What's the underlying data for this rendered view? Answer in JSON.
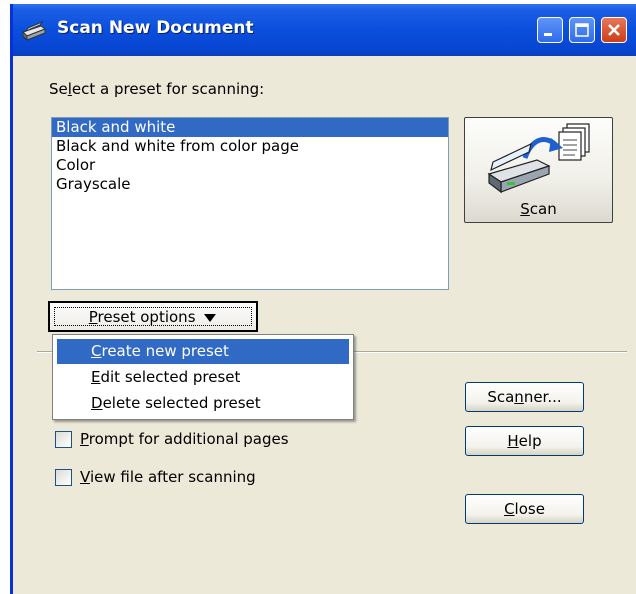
{
  "window": {
    "title": "Scan New Document",
    "buttons": {
      "minimize": "minimize-icon",
      "maximize": "maximize-icon",
      "close": "close-icon"
    }
  },
  "preset_label": {
    "before": "Se",
    "underline": "l",
    "after": "ect a preset for scanning:"
  },
  "presets": [
    {
      "label": "Black and white",
      "selected": true
    },
    {
      "label": "Black and white from color page",
      "selected": false
    },
    {
      "label": "Color",
      "selected": false
    },
    {
      "label": "Grayscale",
      "selected": false
    }
  ],
  "scan_button": {
    "underline": "S",
    "after": "can",
    "icon": "scanner-icon"
  },
  "preset_options_button": {
    "underline": "P",
    "after": "reset options",
    "icon": "dropdown-arrow-icon"
  },
  "preset_menu": [
    {
      "underline": "C",
      "after": "reate new preset",
      "highlighted": true
    },
    {
      "underline": "E",
      "after": "dit selected preset",
      "highlighted": false
    },
    {
      "underline": "D",
      "after": "elete selected preset",
      "highlighted": false
    }
  ],
  "checkboxes": {
    "prompt": {
      "underline": "P",
      "after": "rompt for additional pages",
      "checked": false
    },
    "view": {
      "underline": "V",
      "after": "iew file after scanning",
      "checked": false
    }
  },
  "buttons": {
    "scanner": {
      "before": "Sca",
      "underline": "n",
      "after": "ner..."
    },
    "help": {
      "before": "",
      "underline": "H",
      "after": "elp"
    },
    "close": {
      "before": "",
      "underline": "C",
      "after": "lose"
    }
  },
  "colors": {
    "titlebar": "#0a4fdc",
    "selection": "#316ac5",
    "dialog": "#ece9d8"
  }
}
